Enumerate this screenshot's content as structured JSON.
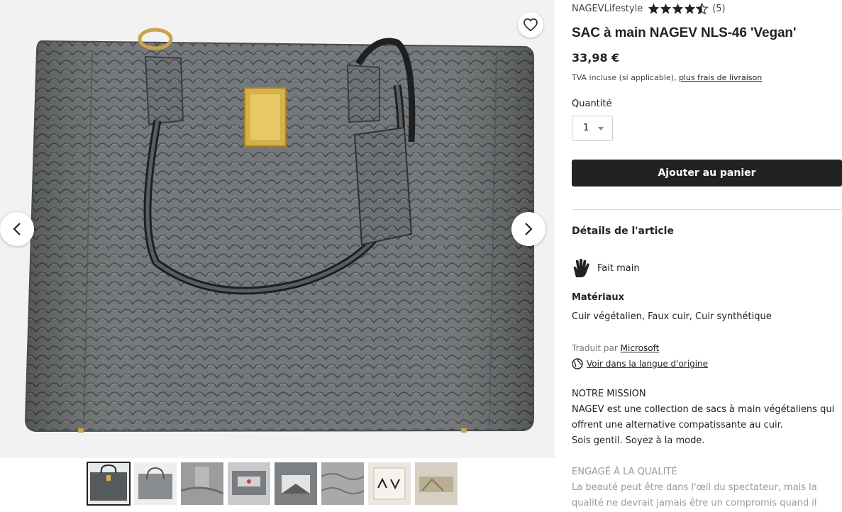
{
  "gallery": {
    "favorite_icon": "heart-icon",
    "prev_icon": "chevron-left-icon",
    "next_icon": "chevron-right-icon",
    "thumbnail_count": 8
  },
  "shop": {
    "name": "NAGEVLifestyle",
    "rating": 4.5,
    "review_count": "(5)"
  },
  "product": {
    "title": "SAC à main NAGEV NLS-46 'Vegan'",
    "price": "33,98 €",
    "tva_text": "TVA incluse (si applicable),",
    "shipping_link": "plus frais de livraison"
  },
  "quantity": {
    "label": "Quantité",
    "value": "1"
  },
  "cart": {
    "add_label": "Ajouter au panier"
  },
  "details": {
    "heading": "Détails de l'article",
    "handmade_icon": "hand-icon",
    "handmade_label": "Fait main",
    "materials_heading": "Matériaux",
    "materials_value": "Cuir végétalien, Faux cuir, Cuir synthétique",
    "translated_by": "Traduit par",
    "translator_link": "Microsoft",
    "globe_icon": "globe-icon",
    "original_language_link": "Voir dans la langue d'origine"
  },
  "description": {
    "mission_heading": "NOTRE MISSION",
    "line1": "NAGEV est une collection de sacs à main végétaliens qui",
    "line2": "offrent une alternative compatissante au cuir.",
    "line3": "Sois gentil. Soyez à la mode.",
    "quality_heading": "ENGAGÉ À LA QUALITÉ",
    "line4": "La beauté peut être dans l'œil du spectateur, mais la",
    "line5": "qualité ne devrait jamais être un compromis quand il"
  },
  "colors": {
    "bag_gray": "#6f7274",
    "button_dark": "#222222",
    "star": "#222222"
  }
}
